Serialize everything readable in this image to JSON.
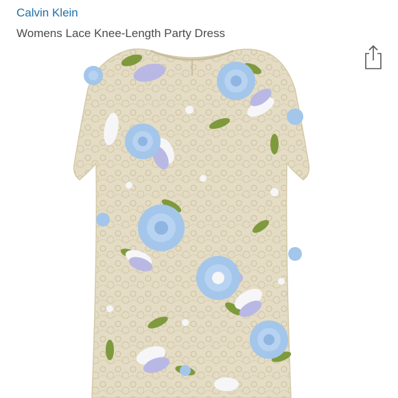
{
  "product": {
    "brand": "Calvin Klein",
    "title": "Womens Lace Knee-Length Party Dress"
  },
  "icons": {
    "share": "share-icon"
  },
  "image": {
    "subject": "dress-photo",
    "colors": {
      "lace": "#e4dcc4",
      "lace_edge": "#cfc4a4",
      "flower_blue": "#a3c6ea",
      "flower_lavender": "#b9b8e4",
      "flower_white": "#f6f6f8",
      "leaf_green": "#7f9a3c"
    }
  }
}
